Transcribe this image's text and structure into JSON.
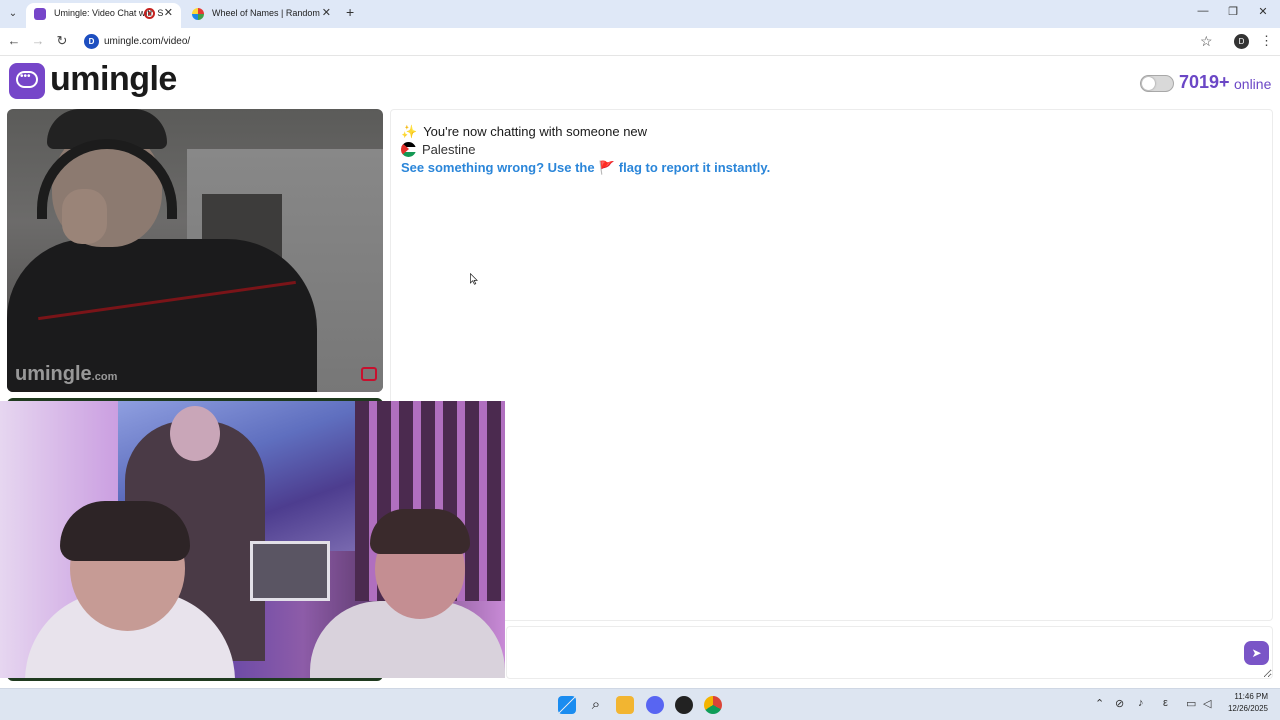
{
  "browser": {
    "tabs": [
      {
        "title": "Umingle: Video Chat with S",
        "active": true
      },
      {
        "title": "Wheel of Names | Random nam",
        "active": false
      }
    ],
    "address": "umingle.com/video/",
    "profile_initial": "D",
    "site_icon_letter": "D"
  },
  "header": {
    "logo_text": "umingle",
    "online_count": "7019+",
    "online_label": "online"
  },
  "remote_video": {
    "watermark": "umingle",
    "watermark_suffix": ".com"
  },
  "chat": {
    "status_message": "You're now chatting with someone new",
    "country": "Palestine",
    "warning_before": "See something wrong? Use the",
    "warning_after": "flag to report it instantly.",
    "input_placeholder": ""
  },
  "taskbar": {
    "time": "11:46 PM",
    "date": "12/26/2025"
  },
  "colors": {
    "brand": "#7646c9",
    "online": "#6b47c6",
    "warning": "#2b86d9",
    "flag": "#d81b60"
  },
  "icons": [
    "logo-chat-icon",
    "toggle-switch",
    "sparkle-icon",
    "palestine-flag-icon",
    "report-flag-icon",
    "send-icon"
  ]
}
